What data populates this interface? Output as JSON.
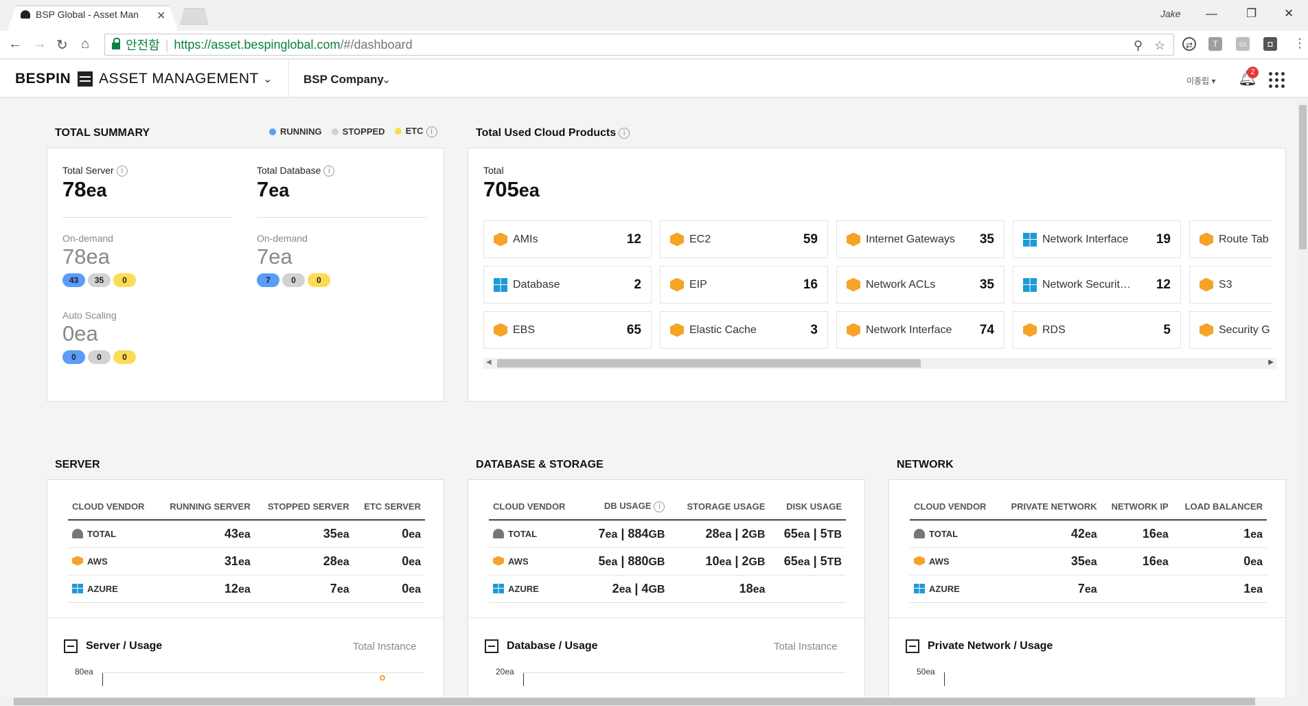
{
  "browser": {
    "tab_title": "BSP Global - Asset Man",
    "user_label": "Jake",
    "secure_label": "안전함",
    "url_host": "https://asset.bespinglobal.com",
    "url_path": "/#/dashboard"
  },
  "header": {
    "brand": "BESPIN",
    "app_name": "ASSET MANAGEMENT",
    "company": "BSP Company",
    "user": "이종립",
    "notification_count": "2"
  },
  "summary": {
    "title": "TOTAL SUMMARY",
    "legend": {
      "running": "RUNNING",
      "stopped": "STOPPED",
      "etc": "ETC"
    },
    "colors": {
      "running": "#5a9cf8",
      "stopped": "#d2d2d2",
      "etc": "#fddb55"
    },
    "server": {
      "label": "Total Server",
      "value": "78",
      "unit": "ea",
      "ondemand_label": "On-demand",
      "ondemand_value": "78ea",
      "ondemand_pills": [
        "43",
        "35",
        "0"
      ],
      "autoscaling_label": "Auto Scaling",
      "autoscaling_value": "0ea",
      "autoscaling_pills": [
        "0",
        "0",
        "0"
      ]
    },
    "database": {
      "label": "Total Database",
      "value": "7",
      "unit": "ea",
      "ondemand_label": "On-demand",
      "ondemand_value": "7ea",
      "ondemand_pills": [
        "7",
        "0",
        "0"
      ]
    }
  },
  "products": {
    "title": "Total Used Cloud Products",
    "total_label": "Total",
    "total_value": "705",
    "total_unit": "ea",
    "items": [
      {
        "name": "AMIs",
        "count": "12",
        "vendor": "aws"
      },
      {
        "name": "Database",
        "count": "2",
        "vendor": "azure"
      },
      {
        "name": "EBS",
        "count": "65",
        "vendor": "aws"
      },
      {
        "name": "EC2",
        "count": "59",
        "vendor": "aws"
      },
      {
        "name": "EIP",
        "count": "16",
        "vendor": "aws"
      },
      {
        "name": "Elastic Cache",
        "count": "3",
        "vendor": "aws"
      },
      {
        "name": "Internet Gateways",
        "count": "35",
        "vendor": "aws"
      },
      {
        "name": "Network ACLs",
        "count": "35",
        "vendor": "aws"
      },
      {
        "name": "Network Interface",
        "count": "74",
        "vendor": "aws"
      },
      {
        "name": "Network Interface",
        "count": "19",
        "vendor": "azure"
      },
      {
        "name": "Network Securit…",
        "count": "12",
        "vendor": "azure"
      },
      {
        "name": "RDS",
        "count": "5",
        "vendor": "aws"
      },
      {
        "name": "Route Tab",
        "count": "",
        "vendor": "aws"
      },
      {
        "name": "S3",
        "count": "",
        "vendor": "aws"
      },
      {
        "name": "Security G",
        "count": "",
        "vendor": "aws"
      }
    ]
  },
  "server": {
    "title": "SERVER",
    "headers": [
      "CLOUD VENDOR",
      "RUNNING SERVER",
      "STOPPED SERVER",
      "ETC SERVER"
    ],
    "rows": [
      {
        "vendor": "TOTAL",
        "icon": "cloud-icon",
        "c1": "43",
        "c2": "35",
        "c3": "0"
      },
      {
        "vendor": "AWS",
        "icon": "aws-icon",
        "c1": "31",
        "c2": "28",
        "c3": "0"
      },
      {
        "vendor": "AZURE",
        "icon": "azure-icon",
        "c1": "12",
        "c2": "7",
        "c3": "0"
      }
    ],
    "usage_title": "Server / Usage",
    "usage_right": "Total Instance",
    "axis_top": "80ea"
  },
  "dbstorage": {
    "title": "DATABASE & STORAGE",
    "headers": [
      "CLOUD VENDOR",
      "DB USAGE",
      "STORAGE USAGE",
      "DISK USAGE"
    ],
    "rows": [
      {
        "vendor": "TOTAL",
        "c1a": "7",
        "c1b": "884",
        "c2a": "28",
        "c2b": "2",
        "c3a": "65",
        "c3b": "5"
      },
      {
        "vendor": "AWS",
        "c1a": "5",
        "c1b": "880",
        "c2a": "10",
        "c2b": "2",
        "c3a": "65",
        "c3b": "5"
      },
      {
        "vendor": "AZURE",
        "c1a": "2",
        "c1b": "4",
        "c2a": "18",
        "c2b": "",
        "c3a": "",
        "c3b": ""
      }
    ],
    "usage_title": "Database / Usage",
    "usage_right": "Total Instance",
    "axis_top": "20ea"
  },
  "network": {
    "title": "NETWORK",
    "headers": [
      "CLOUD VENDOR",
      "PRIVATE NETWORK",
      "NETWORK IP",
      "LOAD BALANCER"
    ],
    "rows": [
      {
        "vendor": "TOTAL",
        "c1": "42",
        "c2": "16",
        "c3": "1"
      },
      {
        "vendor": "AWS",
        "c1": "35",
        "c2": "16",
        "c3": "0"
      },
      {
        "vendor": "AZURE",
        "c1": "7",
        "c2": "",
        "c3": "1"
      }
    ],
    "usage_title": "Private Network / Usage",
    "axis_top": "50ea"
  }
}
